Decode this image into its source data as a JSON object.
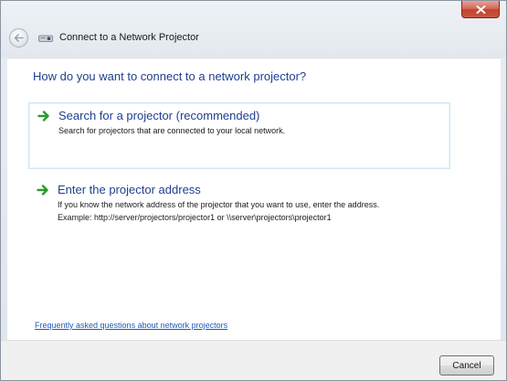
{
  "window": {
    "title": "Connect to a Network Projector"
  },
  "main": {
    "question": "How do you want to connect to a network projector?",
    "options": [
      {
        "title": "Search for a projector (recommended)",
        "description": "Search for projectors that are connected to your local network."
      },
      {
        "title": "Enter the projector address",
        "description_line1": "If you know the network address of the projector that you want to use, enter the address.",
        "description_line2": "Example: http://server/projectors/projector1 or \\\\server\\projectors\\projector1"
      }
    ],
    "faq_link": "Frequently asked questions about network projectors"
  },
  "footer": {
    "cancel_label": "Cancel"
  },
  "icons": {
    "close": "close-icon",
    "back": "back-arrow-icon",
    "app": "network-projector-icon",
    "option_arrow": "green-arrow-icon"
  },
  "colors": {
    "heading": "#1f3f8f",
    "link": "#1f5bb8",
    "arrow": "#2e9a2e",
    "close_button": "#c0452f"
  }
}
